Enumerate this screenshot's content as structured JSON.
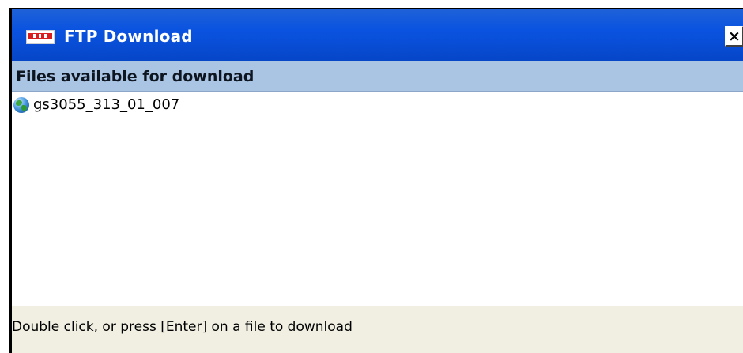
{
  "window": {
    "title": "FTP Download",
    "close_label": "×"
  },
  "header": {
    "title": "Files available for download"
  },
  "files": [
    {
      "name": "gs3055_313_01_007",
      "icon": "globe-icon"
    }
  ],
  "status": {
    "text": "Double click, or press [Enter] on a file to download"
  },
  "colors": {
    "titlebar": "#0a53e0",
    "header_bar": "#aac4e4",
    "window_face": "#ece9d8",
    "app_icon_accent": "#d81e1e"
  }
}
